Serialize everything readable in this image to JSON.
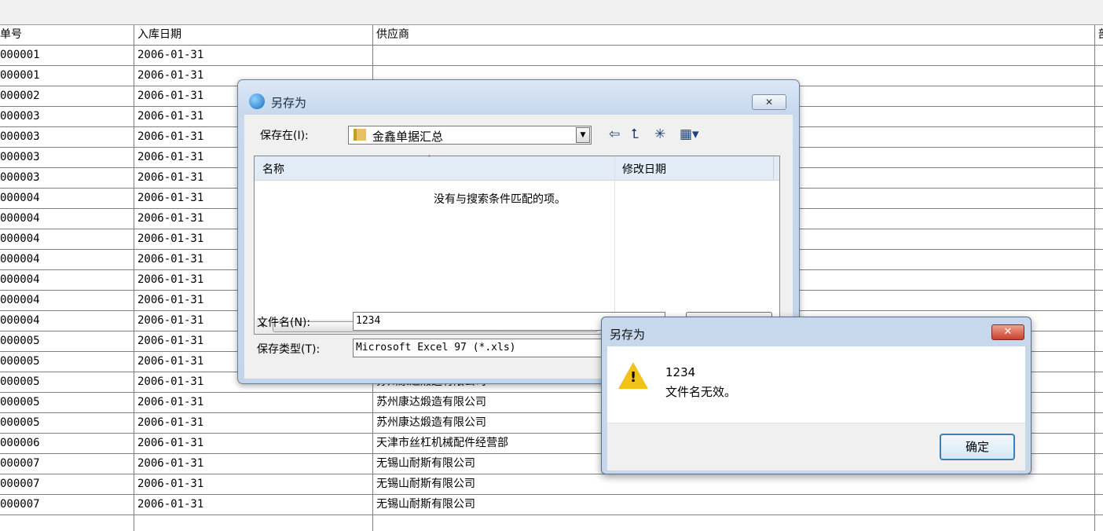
{
  "table": {
    "headers": [
      "单号",
      "入库日期",
      "供应商",
      "部"
    ],
    "rows": [
      [
        "000001",
        "2006-01-31",
        "",
        ""
      ],
      [
        "000001",
        "2006-01-31",
        "",
        ""
      ],
      [
        "000002",
        "2006-01-31",
        "",
        ""
      ],
      [
        "000003",
        "2006-01-31",
        "",
        ""
      ],
      [
        "000003",
        "2006-01-31",
        "",
        ""
      ],
      [
        "000003",
        "2006-01-31",
        "",
        ""
      ],
      [
        "000003",
        "2006-01-31",
        "",
        ""
      ],
      [
        "000004",
        "2006-01-31",
        "",
        ""
      ],
      [
        "000004",
        "2006-01-31",
        "",
        ""
      ],
      [
        "000004",
        "2006-01-31",
        "",
        ""
      ],
      [
        "000004",
        "2006-01-31",
        "",
        ""
      ],
      [
        "000004",
        "2006-01-31",
        "",
        ""
      ],
      [
        "000004",
        "2006-01-31",
        "",
        ""
      ],
      [
        "000004",
        "2006-01-31",
        "",
        ""
      ],
      [
        "000005",
        "2006-01-31",
        "",
        ""
      ],
      [
        "000005",
        "2006-01-31",
        "",
        ""
      ],
      [
        "000005",
        "2006-01-31",
        "苏州康达煅造有限公司",
        ""
      ],
      [
        "000005",
        "2006-01-31",
        "苏州康达煅造有限公司",
        ""
      ],
      [
        "000005",
        "2006-01-31",
        "苏州康达煅造有限公司",
        ""
      ],
      [
        "000006",
        "2006-01-31",
        "天津市丝杠机械配件经营部",
        ""
      ],
      [
        "000007",
        "2006-01-31",
        "无锡山耐斯有限公司",
        ""
      ],
      [
        "000007",
        "2006-01-31",
        "无锡山耐斯有限公司",
        ""
      ],
      [
        "000007",
        "2006-01-31",
        "无锡山耐斯有限公司",
        ""
      ]
    ]
  },
  "save_dialog": {
    "title": "另存为",
    "close_glyph": "✕",
    "look_in_label": "保存在(I):",
    "look_in_value": "金鑫单据汇总",
    "dropdown_glyph": "▼",
    "tools": {
      "back": "⇦",
      "up": "⮤",
      "new_folder": "✳",
      "view": "▦▾"
    },
    "columns": {
      "name": "名称",
      "sort_glyph": "˄",
      "date": "修改日期"
    },
    "empty_message": "没有与搜索条件匹配的项。",
    "scroll": {
      "left": "◂",
      "right": "▸",
      "thumb": "III"
    },
    "file_name_label": "文件名(N):",
    "file_name_value": "1234",
    "file_type_label": "保存类型(T):",
    "file_type_value": "Microsoft Excel 97 (*.xls)"
  },
  "message_box": {
    "title": "另存为",
    "close_glyph": "✕",
    "icon": "warning-icon",
    "warn_glyph": "!",
    "line1": "1234",
    "line2": "文件名无效。",
    "ok_label": "确定"
  }
}
